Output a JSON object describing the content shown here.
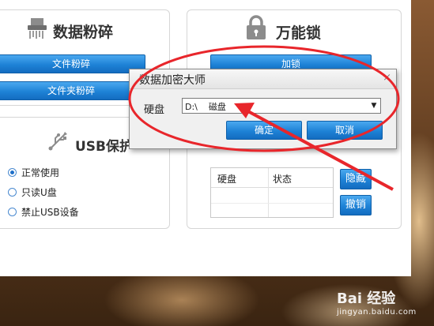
{
  "left_top_panel": {
    "title": "数据粉碎",
    "icon": "shredder-icon",
    "buttons": [
      "文件粉碎",
      "文件夹粉碎"
    ]
  },
  "right_top_panel": {
    "title": "万能锁",
    "icon": "padlock-icon",
    "button": "加锁"
  },
  "usb_panel": {
    "title": "USB保护",
    "icon": "usb-icon",
    "options": [
      {
        "label": "正常使用",
        "checked": true
      },
      {
        "label": "只读U盘",
        "checked": false
      },
      {
        "label": "禁止USB设备",
        "checked": false
      }
    ]
  },
  "disk_panel": {
    "columns": [
      "硬盘",
      "状态"
    ],
    "rows": [],
    "hide_button": "隐藏",
    "undo_button": "撤销"
  },
  "dialog": {
    "title": "数据加密大师",
    "close_glyph": "×",
    "disk_label": "硬盘",
    "disk_value": "D:\\    磁盘",
    "confirm": "确定",
    "cancel": "取消"
  },
  "annotation": {
    "color": "#e8262b"
  },
  "watermark": {
    "main": "Bai 经验",
    "sub": "jingyan.baidu.com"
  }
}
